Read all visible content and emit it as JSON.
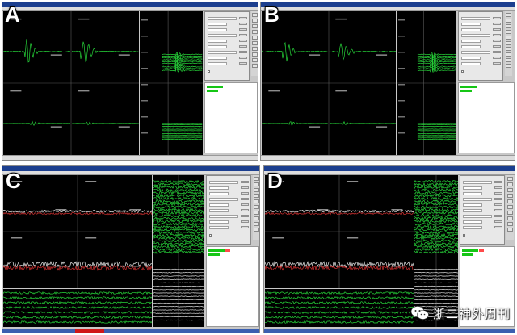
{
  "panels": [
    {
      "id": "A",
      "label": "A"
    },
    {
      "id": "B",
      "label": "B"
    },
    {
      "id": "C",
      "label": "C"
    },
    {
      "id": "D",
      "label": "D"
    }
  ],
  "watermark": {
    "text": "浙二神外周刊",
    "icon": "wechat-icon"
  },
  "colors": {
    "trace_green": "#27d63a",
    "trace_white": "#e8e8e8",
    "trace_red": "#d23030",
    "selected_green": "#16c616",
    "titlebar_blue": "#1c3f8f"
  }
}
